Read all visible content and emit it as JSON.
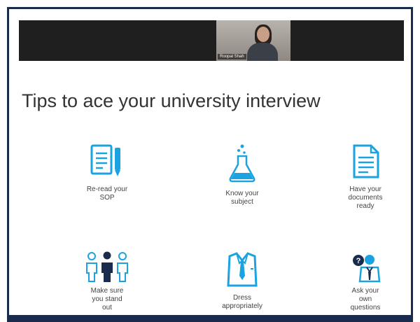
{
  "meeting": {
    "participant_name": "Roopal Shah"
  },
  "slide": {
    "title": "Tips to ace your university interview",
    "tips": [
      {
        "label_lines": [
          "Re-read your",
          "SOP"
        ],
        "icon": "document-pen-icon"
      },
      {
        "label_lines": [
          "Know your",
          "subject"
        ],
        "icon": "flask-icon"
      },
      {
        "label_lines": [
          "Have your",
          "documents",
          "ready"
        ],
        "icon": "document-icon"
      },
      {
        "label_lines": [
          "Make sure",
          "you stand",
          "out"
        ],
        "icon": "people-standout-icon"
      },
      {
        "label_lines": [
          "Dress",
          "appropriately"
        ],
        "icon": "shirt-tie-icon"
      },
      {
        "label_lines": [
          "Ask your",
          "own",
          "questions"
        ],
        "icon": "question-people-icon"
      }
    ]
  },
  "colors": {
    "accent": "#1aa3e0",
    "frame": "#1a2c4d",
    "title_text": "#333333"
  }
}
